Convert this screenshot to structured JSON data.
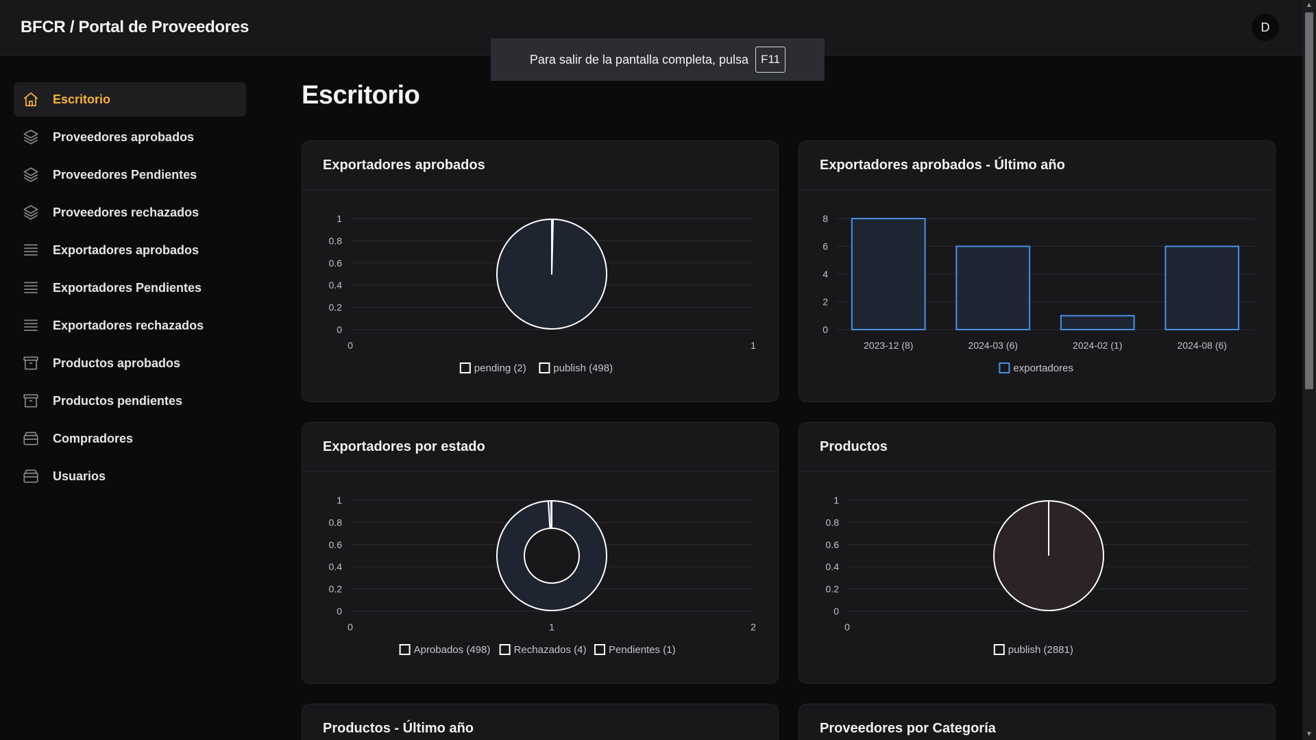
{
  "header": {
    "title": "BFCR / Portal de Proveedores",
    "avatar_initial": "D"
  },
  "fullscreen_notice": {
    "text": "Para salir de la pantalla completa, pulsa",
    "key": "F11"
  },
  "sidebar": {
    "items": [
      {
        "label": "Escritorio",
        "icon": "home-icon",
        "active": true
      },
      {
        "label": "Proveedores aprobados",
        "icon": "layers-icon"
      },
      {
        "label": "Proveedores Pendientes",
        "icon": "layers-icon"
      },
      {
        "label": "Proveedores rechazados",
        "icon": "layers-icon"
      },
      {
        "label": "Exportadores aprobados",
        "icon": "list-icon"
      },
      {
        "label": "Exportadores Pendientes",
        "icon": "list-icon"
      },
      {
        "label": "Exportadores rechazados",
        "icon": "list-icon"
      },
      {
        "label": "Productos aprobados",
        "icon": "archive-icon"
      },
      {
        "label": "Productos pendientes",
        "icon": "archive-icon"
      },
      {
        "label": "Compradores",
        "icon": "database-icon"
      },
      {
        "label": "Usuarios",
        "icon": "database-icon"
      }
    ]
  },
  "main": {
    "title": "Escritorio",
    "cards": {
      "exportadores_aprobados": "Exportadores aprobados",
      "exportadores_ultimo_ano": "Exportadores aprobados - Último año",
      "exportadores_por_estado": "Exportadores por estado",
      "productos": "Productos",
      "productos_ultimo_ano": "Productos - Último año",
      "proveedores_por_categoria": "Proveedores por Categoría"
    }
  },
  "colors": {
    "accent": "#f5b23a",
    "bar_border": "#4a90e2",
    "bar_fill": "#1e2634",
    "pie_fill": "#1e2430",
    "pie_fill_products": "#2b2325"
  },
  "chart_data": [
    {
      "type": "pie",
      "title": "Exportadores aprobados",
      "labels": [
        "pending (2)",
        "publish (498)"
      ],
      "values": [
        2,
        498
      ],
      "y_ticks": [
        "0",
        "0.2",
        "0.4",
        "0.6",
        "0.8",
        "1"
      ],
      "x_ticks": [
        "0",
        "1"
      ],
      "legend": "bottom"
    },
    {
      "type": "bar",
      "title": "Exportadores aprobados - Último año",
      "categories": [
        "2023-12 (8)",
        "2024-03 (6)",
        "2024-02 (1)",
        "2024-08 (6)"
      ],
      "series": [
        {
          "name": "exportadores",
          "values": [
            8,
            6,
            1,
            6
          ]
        }
      ],
      "y_ticks": [
        "0",
        "2",
        "4",
        "6",
        "8"
      ],
      "ylim": [
        0,
        8
      ],
      "legend": "bottom"
    },
    {
      "type": "pie",
      "title": "Exportadores por estado",
      "labels": [
        "Aprobados (498)",
        "Rechazados (4)",
        "Pendientes (1)"
      ],
      "values": [
        498,
        4,
        1
      ],
      "y_ticks": [
        "0",
        "0.2",
        "0.4",
        "0.6",
        "0.8",
        "1"
      ],
      "x_ticks": [
        "0",
        "1",
        "2"
      ],
      "legend": "bottom"
    },
    {
      "type": "pie",
      "title": "Productos",
      "labels": [
        "publish (2881)"
      ],
      "values": [
        2881
      ],
      "y_ticks": [
        "0",
        "0.2",
        "0.4",
        "0.6",
        "0.8",
        "1"
      ],
      "x_ticks": [
        "0"
      ],
      "legend": "bottom"
    }
  ]
}
